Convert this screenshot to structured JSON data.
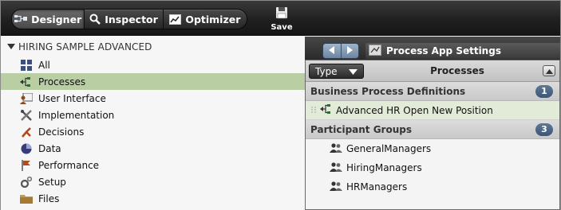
{
  "toolbar": {
    "modes": [
      {
        "label": "Designer",
        "icon": "designer-icon",
        "active": true
      },
      {
        "label": "Inspector",
        "icon": "magnifier-icon",
        "active": false
      },
      {
        "label": "Optimizer",
        "icon": "chart-icon",
        "active": false
      }
    ],
    "save_label": "Save"
  },
  "tree": {
    "root_label": "HIRING SAMPLE ADVANCED",
    "items": [
      {
        "label": "All",
        "icon": "grid-icon"
      },
      {
        "label": "Processes",
        "icon": "process-icon",
        "selected": true
      },
      {
        "label": "User Interface",
        "icon": "user-interface-icon"
      },
      {
        "label": "Implementation",
        "icon": "tools-icon"
      },
      {
        "label": "Decisions",
        "icon": "decision-icon"
      },
      {
        "label": "Data",
        "icon": "data-icon"
      },
      {
        "label": "Performance",
        "icon": "flag-icon"
      },
      {
        "label": "Setup",
        "icon": "gear-icon"
      },
      {
        "label": "Files",
        "icon": "folder-icon"
      }
    ]
  },
  "editor": {
    "tab_label": "Process App Settings"
  },
  "popup": {
    "type_label": "Type",
    "title": "Processes",
    "sections": [
      {
        "label": "Business Process Definitions",
        "count": "1",
        "items": [
          "Advanced HR Open New Position"
        ]
      },
      {
        "label": "Participant Groups",
        "count": "3",
        "items": [
          "GeneralManagers",
          "HiringManagers",
          "HRManagers"
        ]
      }
    ]
  },
  "colors": {
    "selected_row": "#b9cea3",
    "badge": "#4a6482",
    "toolbar_bg": "#202020"
  }
}
